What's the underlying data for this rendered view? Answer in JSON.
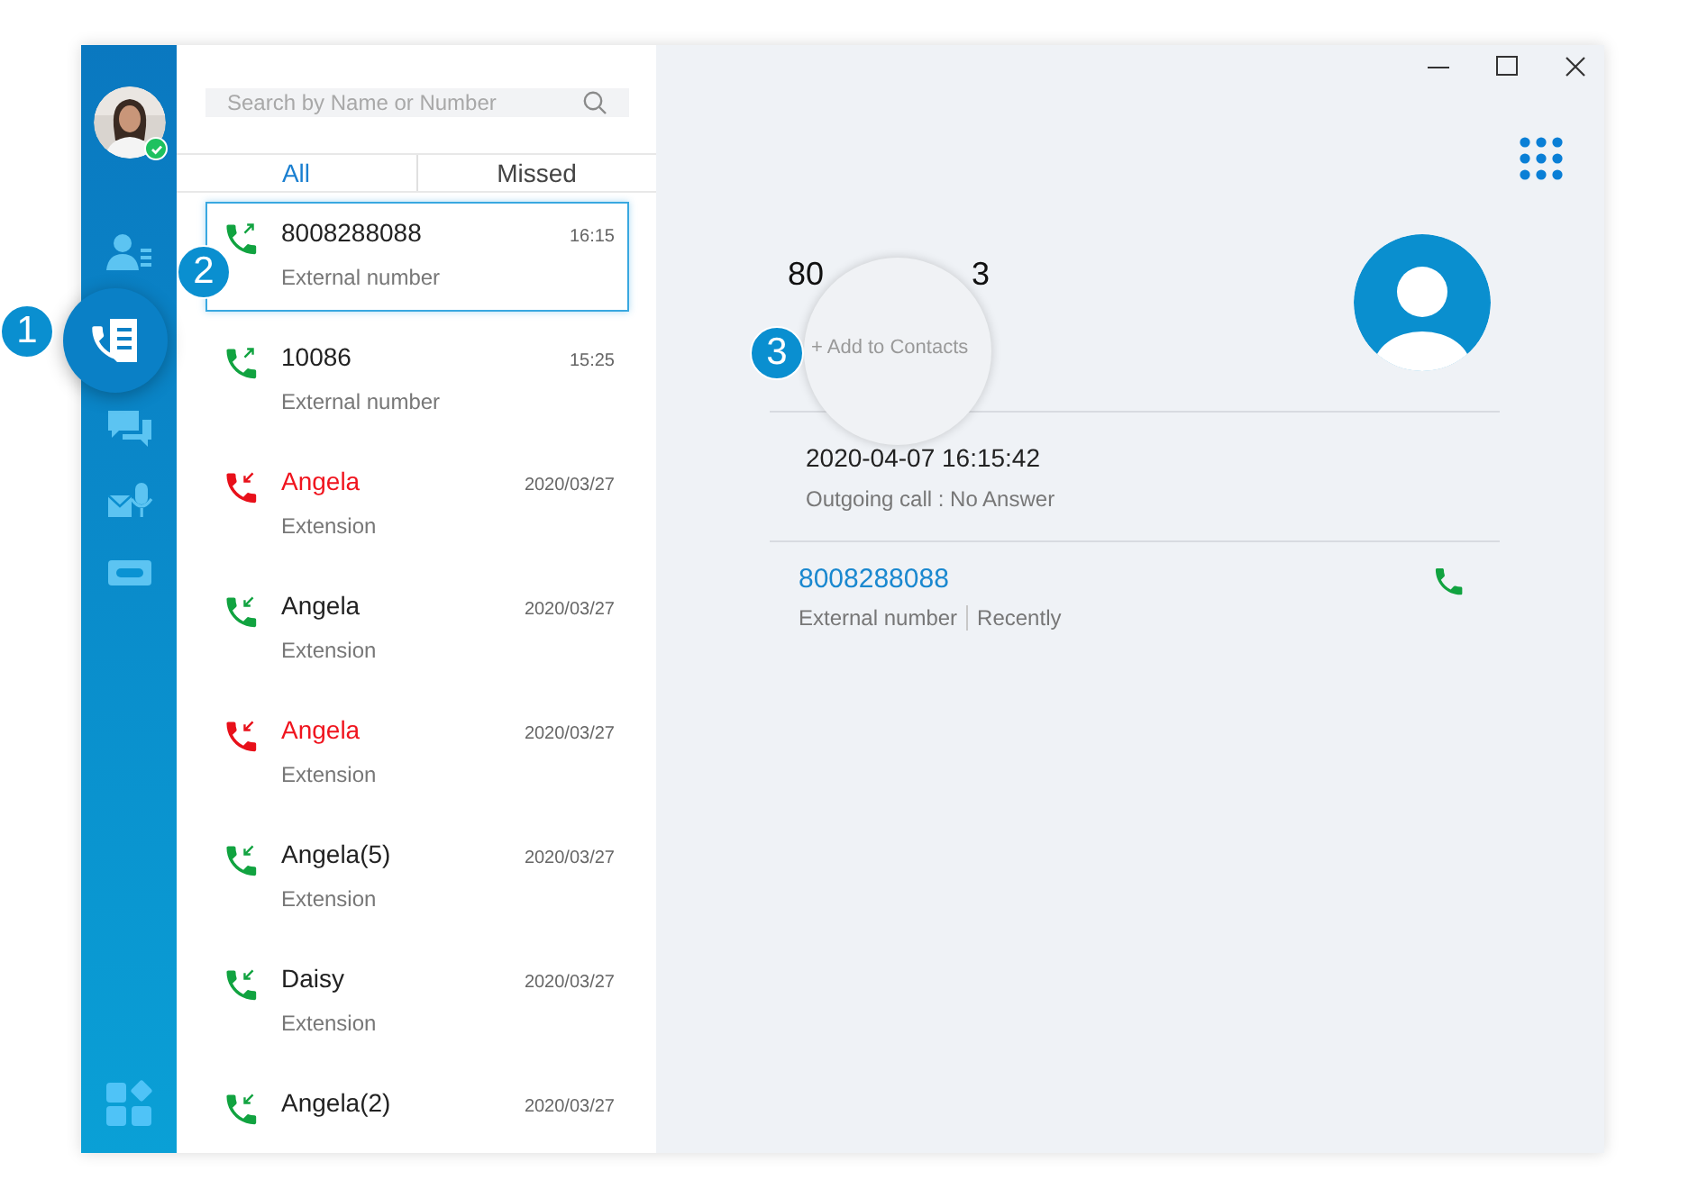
{
  "sidebar": {
    "avatar": {
      "kind": "picture",
      "online": true
    },
    "nav": [
      {
        "kind": "contacts",
        "selected": false
      },
      {
        "kind": "call-log",
        "selected": true
      },
      {
        "kind": "chat",
        "selected": false
      },
      {
        "kind": "voicemail",
        "selected": false
      },
      {
        "kind": "recording",
        "selected": false
      }
    ],
    "bottom": {
      "kind": "apps"
    }
  },
  "search": {
    "placeholder": "Search by Name or Number"
  },
  "tabs": [
    {
      "label": "All",
      "selected": true
    },
    {
      "label": "Missed",
      "selected": false
    }
  ],
  "calls": [
    {
      "name": "8008288088",
      "time": "16:15",
      "detail": "External number",
      "outgoing": true,
      "missed": false,
      "selected": true
    },
    {
      "name": "10086",
      "time": "15:25",
      "detail": "External number",
      "outgoing": true,
      "missed": false,
      "selected": false
    },
    {
      "name": "Angela",
      "time": "2020/03/27",
      "detail": "Extension",
      "outgoing": false,
      "missed": true,
      "selected": false
    },
    {
      "name": "Angela",
      "time": "2020/03/27",
      "detail": "Extension",
      "outgoing": false,
      "missed": false,
      "selected": false
    },
    {
      "name": "Angela",
      "time": "2020/03/27",
      "detail": "Extension",
      "outgoing": false,
      "missed": true,
      "selected": false
    },
    {
      "name": "Angela(5)",
      "time": "2020/03/27",
      "detail": "Extension",
      "outgoing": false,
      "missed": false,
      "selected": false
    },
    {
      "name": "Daisy",
      "time": "2020/03/27",
      "detail": "Extension",
      "outgoing": false,
      "missed": false,
      "selected": false
    },
    {
      "name": "Angela(2)",
      "time": "2020/03/27",
      "outgoing": false,
      "missed": false,
      "selected": false
    }
  ],
  "detail": {
    "number_parts": [
      "80",
      "3"
    ],
    "add_contact": "+ Add to Contacts",
    "record": {
      "datetime": "2020-04-07 16:15:42",
      "status": "Outgoing call : No Answer"
    },
    "contact": {
      "number": "8008288088",
      "type": "External number",
      "when": "Recently"
    }
  },
  "callouts": [
    "1",
    "2",
    "3"
  ]
}
